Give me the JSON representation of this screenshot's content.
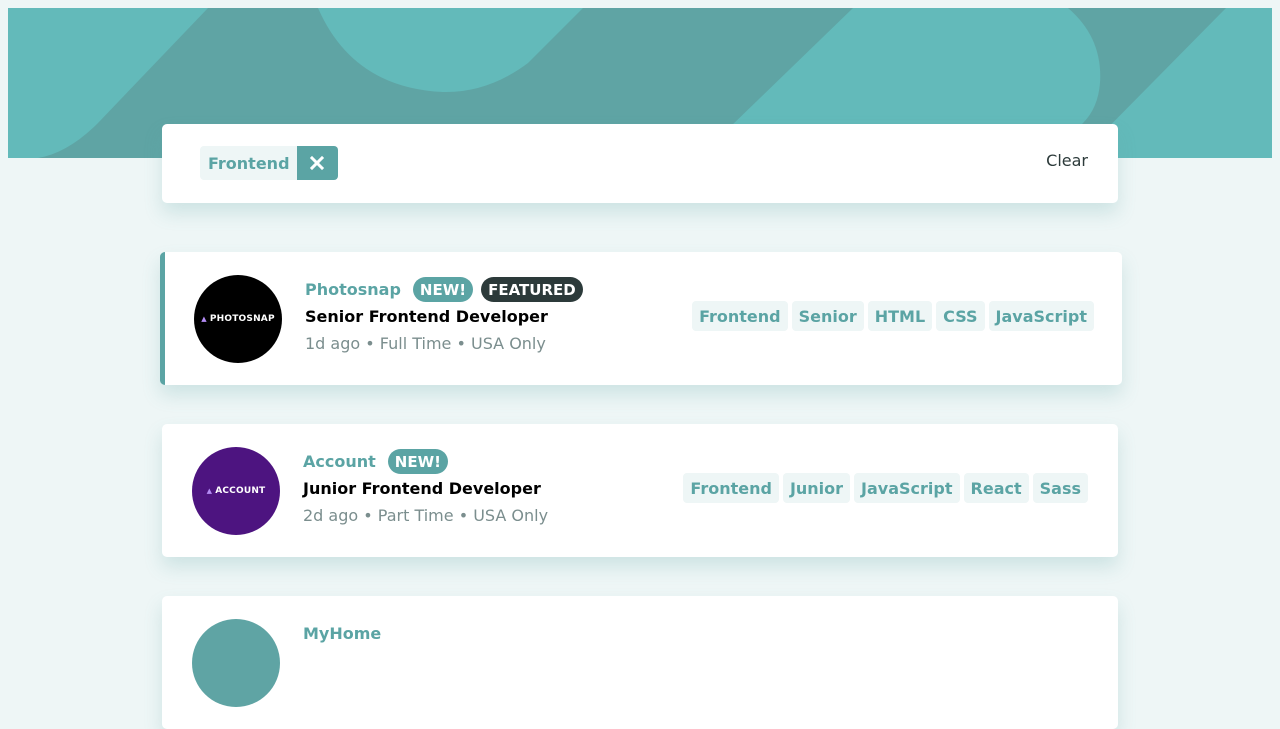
{
  "colors": {
    "primary": "#5ba4a4",
    "background": "#eef6f6",
    "dark": "#2c3a3a",
    "muted": "#7b8e8e"
  },
  "filter": {
    "chips": [
      {
        "label": "Frontend",
        "remove_icon": "close-icon"
      }
    ],
    "clear_label": "Clear"
  },
  "jobs": [
    {
      "company": "Photosnap",
      "new_badge": "NEW!",
      "featured_badge": "FEATURED",
      "position": "Senior Frontend Developer",
      "meta": "1d ago • Full Time • USA Only",
      "logo_text": "PHOTOSNAP",
      "logo_color": "#000000",
      "tags": [
        "Frontend",
        "Senior",
        "HTML",
        "CSS",
        "JavaScript"
      ]
    },
    {
      "company": "Account",
      "new_badge": "NEW!",
      "position": "Junior Frontend Developer",
      "meta": "2d ago • Part Time • USA Only",
      "logo_text": "ACCOUNT",
      "logo_color": "#4d1480",
      "tags": [
        "Frontend",
        "Junior",
        "JavaScript",
        "React",
        "Sass"
      ]
    },
    {
      "company": "MyHome",
      "logo_color": "#5fa4a4"
    }
  ]
}
